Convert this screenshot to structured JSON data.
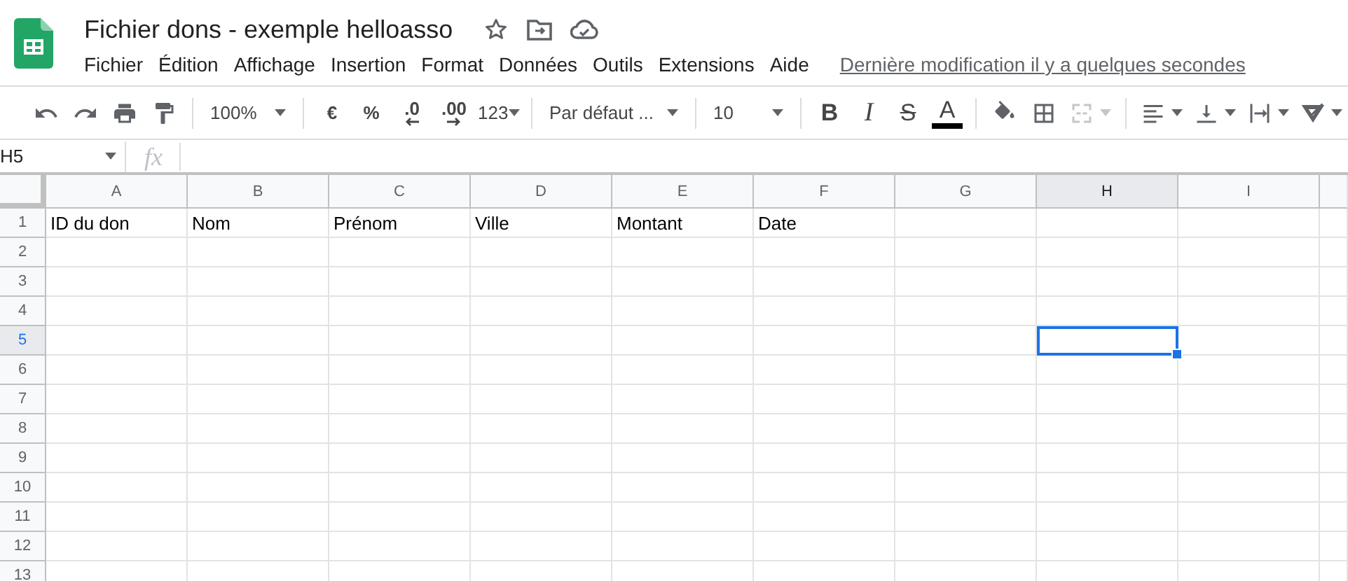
{
  "document": {
    "title": "Fichier dons - exemple helloasso",
    "last_edit": "Dernière modification il y a quelques secondes"
  },
  "menu": [
    "Fichier",
    "Édition",
    "Affichage",
    "Insertion",
    "Format",
    "Données",
    "Outils",
    "Extensions",
    "Aide"
  ],
  "toolbar": {
    "zoom": "100%",
    "currency": "€",
    "percent": "%",
    "decrease_decimals": ".0",
    "increase_decimals": ".00",
    "more_formats": "123",
    "font": "Par défaut ...",
    "font_size": "10",
    "bold": "B",
    "italic": "I",
    "strikethrough": "S",
    "text_color": "A",
    "merge_disabled": true
  },
  "formula_bar": {
    "name_box": "H5",
    "fx": "fx"
  },
  "grid": {
    "columns": [
      {
        "label": "A",
        "selected": false
      },
      {
        "label": "B",
        "selected": false
      },
      {
        "label": "C",
        "selected": false
      },
      {
        "label": "D",
        "selected": false
      },
      {
        "label": "E",
        "selected": false
      },
      {
        "label": "F",
        "selected": false
      },
      {
        "label": "G",
        "selected": false
      },
      {
        "label": "H",
        "selected": true
      },
      {
        "label": "I",
        "selected": false
      }
    ],
    "rows": [
      {
        "number": "1",
        "selected": false,
        "cells": [
          "ID du don",
          "Nom",
          "Prénom",
          "Ville",
          "Montant",
          "Date"
        ]
      },
      {
        "number": "2",
        "selected": false
      },
      {
        "number": "3",
        "selected": false
      },
      {
        "number": "4",
        "selected": false
      },
      {
        "number": "5",
        "selected": true
      },
      {
        "number": "6",
        "selected": false
      },
      {
        "number": "7",
        "selected": false
      },
      {
        "number": "8",
        "selected": false
      },
      {
        "number": "9",
        "selected": false
      },
      {
        "number": "10",
        "selected": false
      },
      {
        "number": "11",
        "selected": false
      },
      {
        "number": "12",
        "selected": false
      },
      {
        "number": "13",
        "selected": false
      }
    ]
  }
}
